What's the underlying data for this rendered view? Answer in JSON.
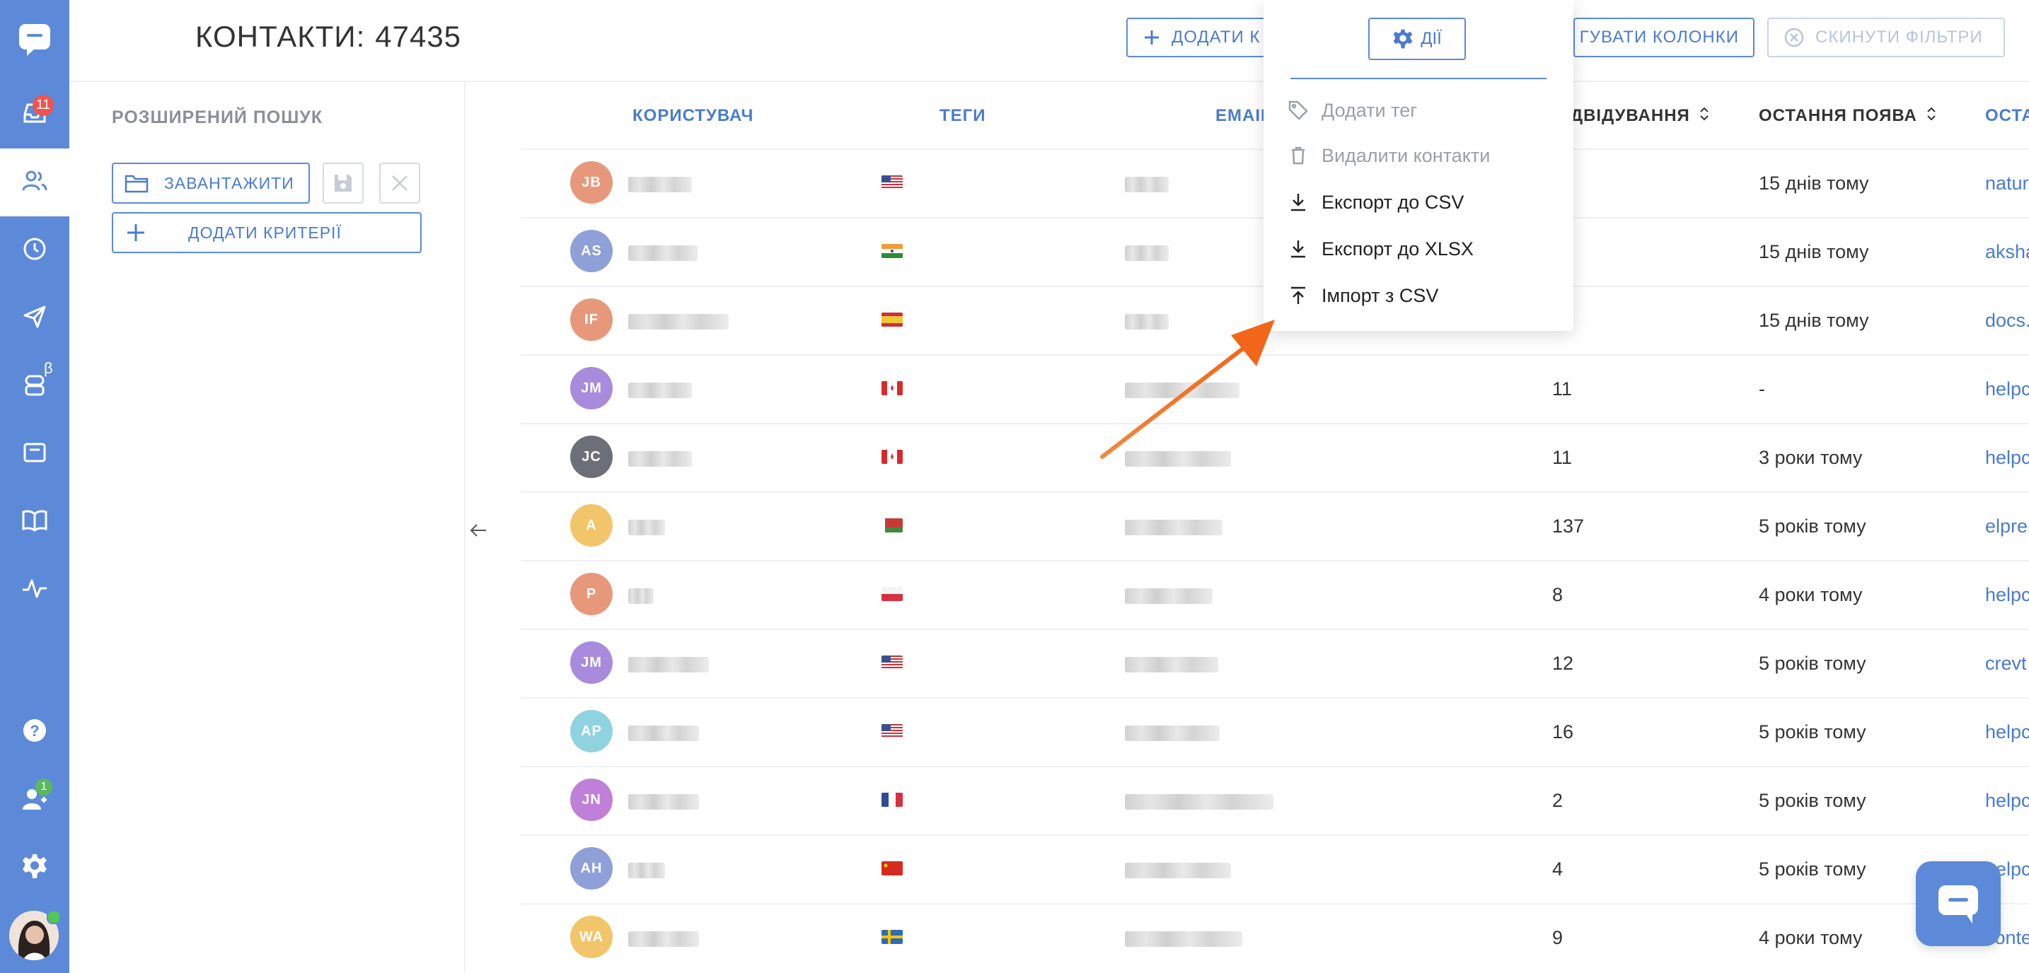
{
  "sidebar": {
    "badges": {
      "inbox": "11",
      "team": "1"
    },
    "beta_label": "β"
  },
  "header": {
    "title": "КОНТАКТИ:",
    "count": "47435",
    "add_contact_label": "ДОДАТИ К",
    "columns_label": "ГУВАТИ КОЛОНКИ",
    "reset_filters_label": "СКИНУТИ ФІЛЬТРИ"
  },
  "search": {
    "title": "РОЗШИРЕНИЙ ПОШУК",
    "load_label": "ЗАВАНТАЖИТИ",
    "add_criteria_label": "ДОДАТИ КРИТЕРІЇ"
  },
  "table": {
    "columns": {
      "user": "КОРИСТУВАЧ",
      "tags": "ТЕГИ",
      "email": "EMAIL",
      "visits": "ВІДВІДУВАННЯ",
      "last_seen": "ОСТАННЯ ПОЯВА",
      "last_page": "ОСТА"
    },
    "rows": [
      {
        "initials": "JB",
        "color": "#e8987a",
        "flag": "us",
        "visits": "",
        "last_seen": "15 днів тому",
        "page": "natur"
      },
      {
        "initials": "AS",
        "color": "#8f9fd8",
        "flag": "in",
        "visits": "",
        "last_seen": "15 днів тому",
        "page": "aksha"
      },
      {
        "initials": "IF",
        "color": "#e8987a",
        "flag": "es",
        "visits": "",
        "last_seen": "15 днів тому",
        "page": "docs."
      },
      {
        "initials": "JM",
        "color": "#a98bdd",
        "flag": "ca",
        "visits": "11",
        "last_seen": "-",
        "page": "helpc"
      },
      {
        "initials": "JC",
        "color": "#6b6f78",
        "flag": "ca",
        "visits": "11",
        "last_seen": "3 роки тому",
        "page": "helpc"
      },
      {
        "initials": "A",
        "color": "#f2c56a",
        "flag": "by",
        "visits": "137",
        "last_seen": "5 років тому",
        "page": "elpre"
      },
      {
        "initials": "P",
        "color": "#e8987a",
        "flag": "pl",
        "visits": "8",
        "last_seen": "4 роки тому",
        "page": "helpc"
      },
      {
        "initials": "JM",
        "color": "#a98bdd",
        "flag": "us",
        "visits": "12",
        "last_seen": "5 років тому",
        "page": "crevt"
      },
      {
        "initials": "AP",
        "color": "#8fd3e0",
        "flag": "us",
        "visits": "16",
        "last_seen": "5 років тому",
        "page": "helpc"
      },
      {
        "initials": "JN",
        "color": "#c07fd8",
        "flag": "fr",
        "visits": "2",
        "last_seen": "5 років тому",
        "page": "helpc"
      },
      {
        "initials": "AH",
        "color": "#8f9fd8",
        "flag": "cn",
        "visits": "4",
        "last_seen": "5 років тому",
        "page": "helpc"
      },
      {
        "initials": "WA",
        "color": "#f2c56a",
        "flag": "se",
        "visits": "9",
        "last_seen": "4 роки тому",
        "page": "conte"
      }
    ]
  },
  "actions_menu": {
    "button_label": "ДІЇ",
    "items": [
      {
        "label": "Додати тег",
        "icon": "tag-icon",
        "disabled": true
      },
      {
        "label": "Видалити контакти",
        "icon": "trash-icon",
        "disabled": true
      },
      {
        "label": "Експорт до CSV",
        "icon": "download-icon",
        "disabled": false
      },
      {
        "label": "Експорт до XLSX",
        "icon": "download-icon",
        "disabled": false
      },
      {
        "label": "Імпорт з CSV",
        "icon": "upload-icon",
        "disabled": false
      }
    ]
  },
  "colors": {
    "accent": "#5c8ad8",
    "link": "#4a7bd0",
    "annotation_arrow": "#f26b1d"
  }
}
